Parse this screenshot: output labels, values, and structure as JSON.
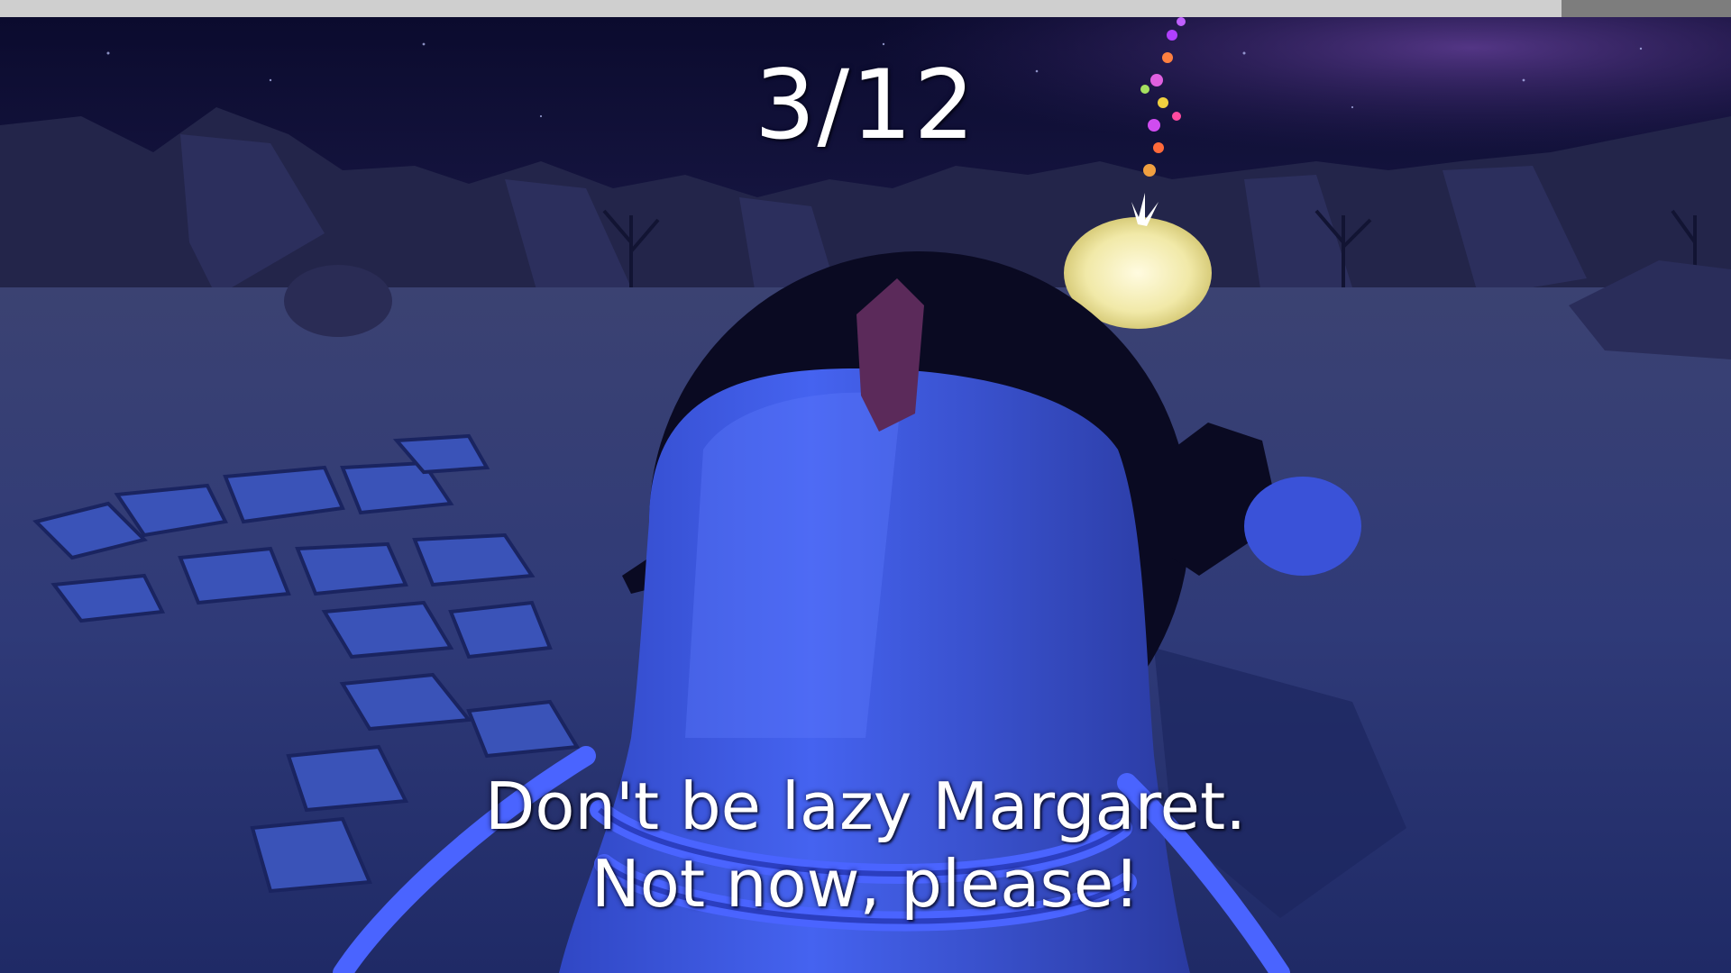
{
  "hud": {
    "progress_text": "3/12",
    "progress": {
      "current": 3,
      "total": 12
    }
  },
  "subtitle": {
    "line1": "Don't be lazy Margaret.",
    "line2": "Not now, please!"
  },
  "colors": {
    "sky_top": "#0b0b2e",
    "sky_purple": "#3a2a6a",
    "ground": "#2f3a6e",
    "ground_light": "#4455a0",
    "cliffs": "#23254a",
    "character_body": "#3a55d8",
    "character_highlight": "#5e7cff",
    "helmet": "#0a0a22",
    "rope": "#4a64ff",
    "beacon": "#f7f2c6",
    "text": "#ffffff"
  },
  "icons": {
    "player": "penguin-character",
    "goal": "glowing-egg-beacon"
  }
}
